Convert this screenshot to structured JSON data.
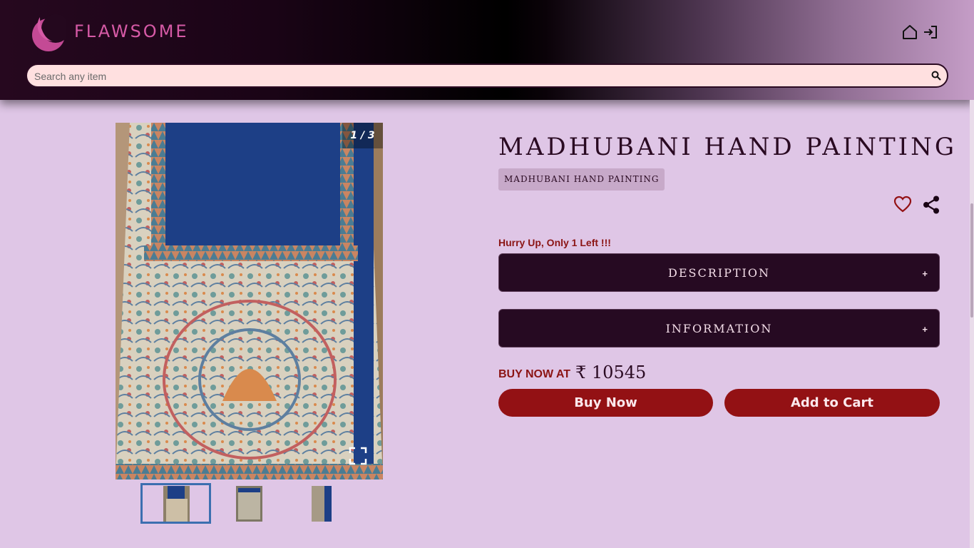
{
  "header": {
    "brand": "FLAWSOME",
    "icons": [
      "home-icon",
      "login-icon"
    ],
    "search_placeholder": "Search any item"
  },
  "gallery": {
    "counter": "1 / 3",
    "total_images": 3,
    "active_index": 1
  },
  "product": {
    "title": "MADHUBANI HAND PAINTING",
    "tag": "MADHUBANI HAND PAINTING",
    "stock_note": "Hurry Up, Only 1 Left !!!",
    "accordions": [
      {
        "label": "DESCRIPTION",
        "toggle": "+"
      },
      {
        "label": "INFORMATION",
        "toggle": "+"
      }
    ],
    "buy_now_label": "BUY NOW AT",
    "price": "₹ 10545",
    "buy_button": "Buy Now",
    "cart_button": "Add to Cart"
  },
  "colors": {
    "background": "#dfc6e6",
    "brand": "#d65aa6",
    "accent": "#931114",
    "dark": "#260a22"
  }
}
